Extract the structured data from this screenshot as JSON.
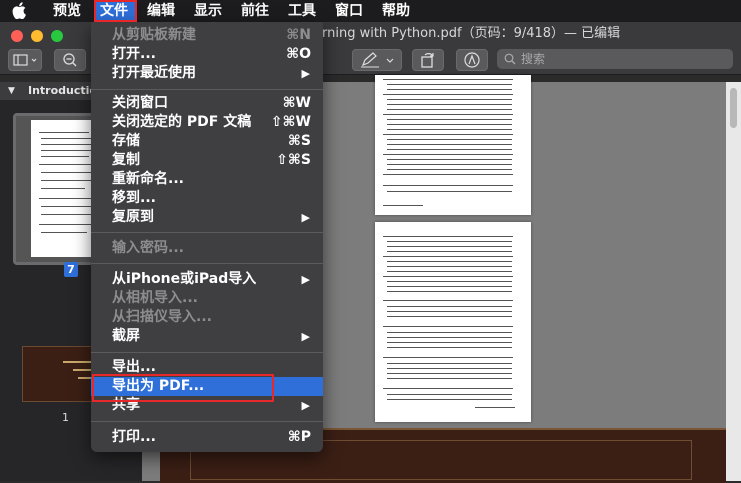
{
  "menubar": {
    "apple_icon": "apple-icon",
    "items": [
      "预览",
      "文件",
      "编辑",
      "显示",
      "前往",
      "工具",
      "窗口",
      "帮助"
    ]
  },
  "window": {
    "title_fragment": "rning with Python.pdf（页码：9/418）— 已编辑"
  },
  "toolbar": {
    "search_placeholder": "搜索"
  },
  "sidebar": {
    "header": "Introductio",
    "thumb1_number": "7",
    "thumb2_number": "1"
  },
  "file_menu": {
    "items": [
      {
        "label": "从剪贴板新建",
        "shortcut": "⌘N",
        "disabled": true
      },
      {
        "label": "打开...",
        "shortcut": "⌘O"
      },
      {
        "label": "打开最近使用",
        "submenu": "▶"
      },
      {
        "label": "关闭窗口",
        "shortcut": "⌘W"
      },
      {
        "label": "关闭选定的 PDF 文稿",
        "shortcut": "⇧⌘W"
      },
      {
        "label": "存储",
        "shortcut": "⌘S"
      },
      {
        "label": "复制",
        "shortcut": "⇧⌘S"
      },
      {
        "label": "重新命名..."
      },
      {
        "label": "移到..."
      },
      {
        "label": "复原到",
        "submenu": "▶"
      },
      {
        "label": "输入密码...",
        "disabled": true
      },
      {
        "label": "从iPhone或iPad导入",
        "submenu": "▶"
      },
      {
        "label": "从相机导入...",
        "disabled": true
      },
      {
        "label": "从扫描仪导入...",
        "disabled": true
      },
      {
        "label": "截屏",
        "submenu": "▶"
      },
      {
        "label": "导出..."
      },
      {
        "label": "导出为 PDF..."
      },
      {
        "label": "共享",
        "submenu": "▶"
      },
      {
        "label": "打印...",
        "shortcut": "⌘P"
      }
    ]
  },
  "colors": {
    "highlight": "#2e6fd9",
    "annotation_box": "#e8272b"
  }
}
